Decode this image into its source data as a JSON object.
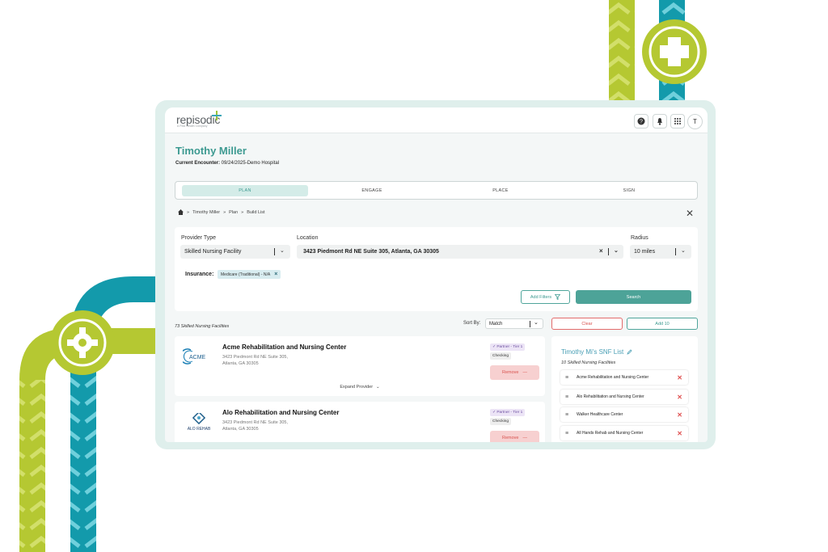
{
  "app": {
    "logo_text": "repisodic",
    "logo_sub": "A Pear Health Company"
  },
  "topbar": {
    "avatar_initial": "T"
  },
  "patient": {
    "name": "Timothy Miller",
    "encounter_label": "Current Encounter:",
    "encounter_value": " 09/24/2025-Demo Hospital"
  },
  "tabs": [
    {
      "label": "PLAN",
      "active": true
    },
    {
      "label": "ENGAGE",
      "active": false
    },
    {
      "label": "PLACE",
      "active": false
    },
    {
      "label": "SIGN",
      "active": false
    }
  ],
  "breadcrumb": [
    "Timothy Miller",
    "Plan",
    "Build List"
  ],
  "filters": {
    "provider_type_label": "Provider Type",
    "provider_type_value": "Skilled Nursing Facility",
    "location_label": "Location",
    "location_value": "3423 Piedmont Rd NE Suite 305, Atlanta, GA 30305",
    "radius_label": "Radius",
    "radius_value": "10 miles",
    "insurance_label": "Insurance:",
    "insurance_chip": "Medicare (Traditional) - N/A",
    "add_filters_label": "Add Filters",
    "search_label": "Search"
  },
  "results": {
    "count_text": "73 Skilled Nursing Facilities",
    "sort_label": "Sort By:",
    "sort_value": "Match",
    "clear_label": "Clear",
    "add10_label": "Add 10"
  },
  "providers": [
    {
      "name": "Acme Rehabilitation and Nursing Center",
      "address_line1": "3423 Piedmont Rd NE Suite 305,",
      "address_line2": "Atlanta, GA 30305",
      "partner_tag": "✓ Partner - Tier 1",
      "status_tag": "Checking",
      "remove_label": "Remove",
      "expand_label": "Expand Provider",
      "logo_text": "ACME"
    },
    {
      "name": "Alo Rehabilitation and Nursing Center",
      "address_line1": "3423 Piedmont Rd NE Suite 305,",
      "address_line2": "Atlanta, GA 30305",
      "partner_tag": "✓ Partner - Tier 1",
      "status_tag": "Checking",
      "remove_label": "Remove",
      "logo_text": "ALO REHAB"
    }
  ],
  "snf_list": {
    "title": "Timothy Mi's SNF List",
    "subtitle": "10 Skilled Nursing Facilities",
    "items": [
      "Acme Rehabilitation and Nursing Center",
      "Alo Rehabilitation and Nursing Center",
      "Walker Healthcare Center",
      "All Hands Rehab and Nursing Center"
    ]
  },
  "colors": {
    "teal": "#3d9a91",
    "lime": "#b5c832",
    "cyan": "#139aab",
    "danger": "#d9534f"
  }
}
